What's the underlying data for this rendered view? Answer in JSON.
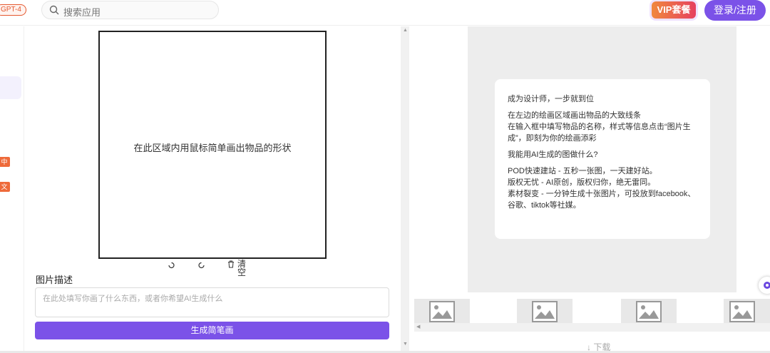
{
  "header": {
    "gpt_badge": "GPT-4",
    "search_placeholder": "搜索应用",
    "vip_label": "VIP套餐",
    "login_label": "登录/注册"
  },
  "leftnav": {
    "tags": [
      "中",
      "文中"
    ]
  },
  "canvas": {
    "hint": "在此区域内用鼠标简单画出物品的形状",
    "tools": {
      "clear_label": "清空"
    }
  },
  "description": {
    "label": "图片描述",
    "placeholder": "在此处填写你画了什么东西，或者你希望AI生成什么"
  },
  "generate_button": "生成简笔画",
  "info_card": {
    "line1": "成为设计师，一步就到位",
    "line2": "在左边的绘画区域画出物品的大致线条",
    "line3": "在输入框中填写物品的名称，样式等信息点击“图片生成”，即刻为你的绘画添彩",
    "heading2": "我能用AI生成的图做什么?",
    "line4": "POD快速建站 - 五秒一张图，一天建好站。",
    "line5": "版权无忧 - AI原创，版权归你，绝无雷同。",
    "line6": "素材裂变 - 一分钟生成十张图片，可投放到facebook、谷歌、tiktok等社媒。"
  },
  "download_label": "↓ 下载",
  "colors": {
    "accent": "#7b52e8",
    "vip_gradient_start": "#f0883e",
    "vip_gradient_end": "#e6405f",
    "tag": "#ee6a3a"
  },
  "icons": {
    "search": "search-icon",
    "undo": "undo-icon",
    "redo": "redo-icon",
    "trash": "trash-icon",
    "image_placeholder": "image-placeholder-icon"
  }
}
